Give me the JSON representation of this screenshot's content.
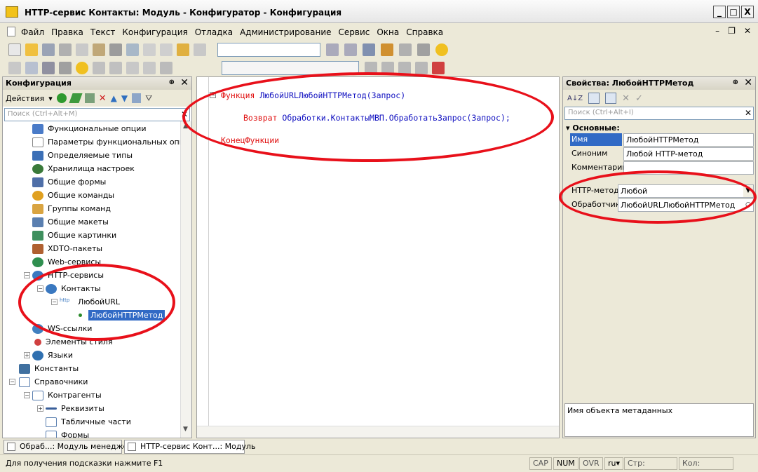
{
  "window": {
    "title": "HTTP-сервис Контакты: Модуль - Конфигуратор - Конфигурация",
    "controls": [
      "_",
      "□",
      "X"
    ]
  },
  "menu": {
    "items": [
      "Файл",
      "Правка",
      "Текст",
      "Конфигурация",
      "Отладка",
      "Администрирование",
      "Сервис",
      "Окна",
      "Справка"
    ]
  },
  "left_panel": {
    "title": "Конфигурация",
    "actions_label": "Действия",
    "search_placeholder": "Поиск (Ctrl+Alt+M)",
    "tree": [
      {
        "label": "Функциональные опции",
        "icon": "functional-options-icon",
        "color": "#4a7bc8"
      },
      {
        "label": "Параметры функциональных опций",
        "icon": "params-icon",
        "color": "#6b6b6b"
      },
      {
        "label": "Определяемые типы",
        "icon": "types-icon",
        "color": "#3b6fb6"
      },
      {
        "label": "Хранилища настроек",
        "icon": "storage-icon",
        "color": "#3a7a3a"
      },
      {
        "label": "Общие формы",
        "icon": "form-icon",
        "color": "#4f6fa8"
      },
      {
        "label": "Общие команды",
        "icon": "command-icon",
        "color": "#e0a020"
      },
      {
        "label": "Группы команд",
        "icon": "group-icon",
        "color": "#d9a441"
      },
      {
        "label": "Общие макеты",
        "icon": "template-icon",
        "color": "#5a7fb0"
      },
      {
        "label": "Общие картинки",
        "icon": "picture-icon",
        "color": "#3e8f5e"
      },
      {
        "label": "XDTO-пакеты",
        "icon": "xdto-icon",
        "color": "#b06030"
      },
      {
        "label": "Web-сервисы",
        "icon": "globe-icon",
        "color": "#2f8f4f"
      },
      {
        "label": "HTTP-сервисы",
        "icon": "http-icon",
        "color": "#3a78c0"
      },
      {
        "label": "Контакты",
        "icon": "http-service-icon",
        "color": "#3a78c0"
      },
      {
        "label": "ЛюбойURL",
        "icon": "http-url-icon",
        "color": "#3a78c0"
      },
      {
        "label": "ЛюбойHTTPМетод",
        "icon": "method-icon",
        "color": "#2a8a2a"
      },
      {
        "label": "WS-ссылки",
        "icon": "ws-icon",
        "color": "#4080c0"
      },
      {
        "label": "Элементы стиля",
        "icon": "style-icon",
        "color": "#d04040"
      },
      {
        "label": "Языки",
        "icon": "language-icon",
        "color": "#3070b0"
      },
      {
        "label": "Константы",
        "icon": "constants-icon",
        "color": "#4070a0"
      },
      {
        "label": "Справочники",
        "icon": "catalog-icon",
        "color": "#5a7fb0"
      },
      {
        "label": "Контрагенты",
        "icon": "catalog-item-icon",
        "color": "#5a7fb0"
      },
      {
        "label": "Реквизиты",
        "icon": "attribute-icon",
        "color": "#3a5f9a"
      },
      {
        "label": "Табличные части",
        "icon": "table-part-icon",
        "color": "#5a7fb0"
      },
      {
        "label": "Формы",
        "icon": "forms-icon",
        "color": "#5a7fb0"
      }
    ]
  },
  "editor": {
    "line1_kw": "Функция",
    "line1_name": "ЛюбойURLЛюбойHTTPМетод",
    "line1_args": "(Запрос)",
    "line2_kw": "Возврат",
    "line2_expr": "Обработки.КонтактыМВП.ОбработатьЗапрос",
    "line2_args": "(Запрос);",
    "line3_kw": "КонецФункции"
  },
  "properties": {
    "title": "Свойства: ЛюбойHTTPМетод",
    "search_placeholder": "Поиск (Ctrl+Alt+I)",
    "section": "Основные:",
    "rows": [
      {
        "label": "Имя",
        "value": "ЛюбойHTTPМетод"
      },
      {
        "label": "Синоним",
        "value": "Любой HTTP-метод"
      },
      {
        "label": "Комментарий",
        "value": ""
      },
      {
        "label": "HTTP-метод",
        "value": "Любой"
      },
      {
        "label": "Обработчик",
        "value": "ЛюбойURLЛюбойHTTPМетод"
      }
    ],
    "description": "Имя объекта метаданных"
  },
  "window_tabs": [
    "Обраб...: Модуль менеджера",
    "HTTP-сервис Конт...: Модуль"
  ],
  "status": {
    "hint": "Для получения подсказки нажмите F1",
    "cap": "CAP",
    "num": "NUM",
    "ovr": "OVR",
    "lang": "ru",
    "row_label": "Стр:",
    "col_label": "Кол:"
  },
  "colors": {
    "annotation": "#e8101a",
    "keyword": "#e01010",
    "identifier": "#1010c0",
    "selection": "#316ac5"
  }
}
